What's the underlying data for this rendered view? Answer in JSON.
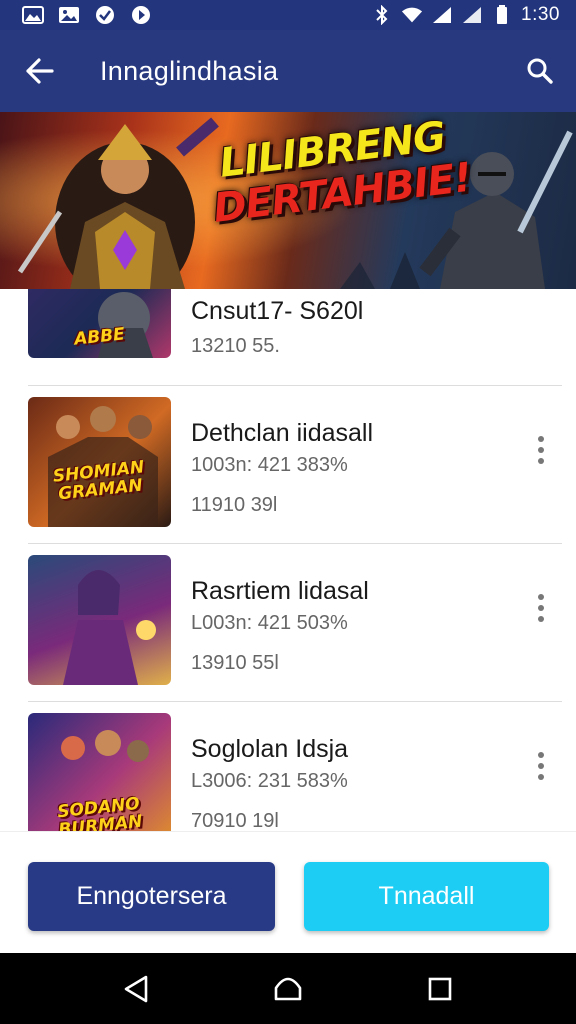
{
  "status_bar": {
    "time": "1:30",
    "icons": [
      "gallery-icon",
      "image-icon",
      "check-circle-icon",
      "play-circle-icon",
      "bluetooth-icon",
      "wifi-icon",
      "signal-icon",
      "signal-icon",
      "battery-icon"
    ]
  },
  "app_bar": {
    "title": "Innaglindhasia",
    "back_icon": "arrow-left-icon",
    "search_icon": "search-icon"
  },
  "banner": {
    "title_line1": "LILIBRENG",
    "title_line2": "DERTAHBIE!"
  },
  "list": {
    "items": [
      {
        "thumb_text": "ABBE",
        "title": "Cnsut17- S620l",
        "subtitle": "",
        "meta": "13210 55.",
        "colors": [
          "#3a2a6a",
          "#1c2a55",
          "#b0386a"
        ]
      },
      {
        "thumb_text": "SHOMIAN GRAMAN",
        "title": "Dethclan iidasall",
        "subtitle": "1003n: 421 383%",
        "meta": "11910 39l",
        "colors": [
          "#6b2a16",
          "#d06a24",
          "#2a1a14"
        ]
      },
      {
        "thumb_text": "",
        "title": "Rasrtiem lidasal",
        "subtitle": "L003n: 421 503%",
        "meta": "13910 55l",
        "colors": [
          "#2a4a7a",
          "#7a2a7a",
          "#e0b04a"
        ]
      },
      {
        "thumb_text": "SODANO BURMAN",
        "title": "Soglolan Idsja",
        "subtitle": "L3006: 231 583%",
        "meta": "70910 19l",
        "colors": [
          "#2a2a7a",
          "#a83a7a",
          "#e0902a"
        ]
      }
    ]
  },
  "actions": {
    "primary_label": "Enngotersera",
    "accent_label": "Tnnadall",
    "primary_color": "#283a86",
    "accent_color": "#1ecdf3"
  },
  "nav_bar": {
    "back_icon": "triangle-back-icon",
    "home_icon": "home-icon",
    "recents_icon": "square-recents-icon"
  }
}
